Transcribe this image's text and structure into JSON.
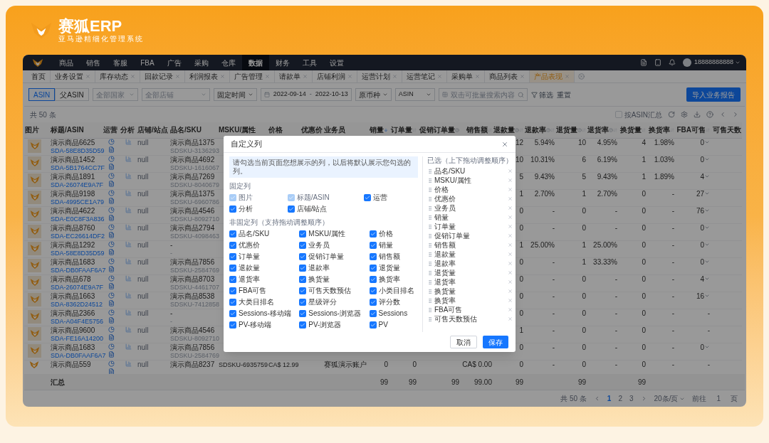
{
  "brand": {
    "name": "赛狐ERP",
    "tagline": "亚马逊精细化管理系统"
  },
  "nav": {
    "items": [
      {
        "label": "商品",
        "selected": false
      },
      {
        "label": "销售",
        "selected": false
      },
      {
        "label": "客服",
        "selected": false
      },
      {
        "label": "FBA",
        "selected": false
      },
      {
        "label": "广告",
        "selected": false
      },
      {
        "label": "采购",
        "selected": false
      },
      {
        "label": "仓库",
        "selected": false
      },
      {
        "label": "数据",
        "selected": true
      },
      {
        "label": "财务",
        "selected": false
      },
      {
        "label": "工具",
        "selected": false
      },
      {
        "label": "设置",
        "selected": false
      }
    ],
    "user": "18888888888"
  },
  "tabs": [
    {
      "label": "首页",
      "selected": false,
      "closable": false
    },
    {
      "label": "业务设置",
      "selected": false,
      "closable": true
    },
    {
      "label": "库存动态",
      "selected": false,
      "closable": true
    },
    {
      "label": "回款记录",
      "selected": false,
      "closable": true
    },
    {
      "label": "利润报表",
      "selected": false,
      "closable": true
    },
    {
      "label": "广告管理",
      "selected": false,
      "closable": true
    },
    {
      "label": "请款单",
      "selected": false,
      "closable": true
    },
    {
      "label": "店铺利润",
      "selected": false,
      "closable": true
    },
    {
      "label": "运营计划",
      "selected": false,
      "closable": true
    },
    {
      "label": "运营笔记",
      "selected": false,
      "closable": true
    },
    {
      "label": "采购单",
      "selected": false,
      "closable": true
    },
    {
      "label": "商品列表",
      "selected": false,
      "closable": true
    },
    {
      "label": "产品表现",
      "selected": true,
      "closable": true
    }
  ],
  "toolbar": {
    "segments": [
      {
        "label": "ASIN",
        "selected": true
      },
      {
        "label": "父ASIN",
        "selected": false
      }
    ],
    "country": "全部国家",
    "shop": "全部店铺",
    "time_mode": "固定时间",
    "date_start": "2022-09-14",
    "date_end": "2022-10-13",
    "date_separator": "-",
    "currency": "原币种",
    "search_type": "ASIN",
    "search_placeholder": "双击可批量搜索内容",
    "filter": "筛选",
    "reset": "重置",
    "import_button": "导入业务报告"
  },
  "table": {
    "total": "共 50 条",
    "group_by_asin": {
      "label": "按ASIN汇总",
      "checked": false
    },
    "columns": [
      {
        "label": "图片",
        "help": false,
        "sortable": false
      },
      {
        "label": "标题/ASIN",
        "help": false,
        "sortable": false
      },
      {
        "label": "运营",
        "help": false,
        "sortable": false
      },
      {
        "label": "分析",
        "help": false,
        "sortable": false
      },
      {
        "label": "店铺/站点",
        "help": false,
        "sortable": false
      },
      {
        "label": "品名/SKU",
        "help": false,
        "sortable": false
      },
      {
        "label": "MSKU/属性",
        "help": false,
        "sortable": false
      },
      {
        "label": "价格",
        "help": false,
        "sortable": false
      },
      {
        "label": "优惠价",
        "help": false,
        "sortable": false
      },
      {
        "label": "业务员",
        "help": false,
        "sortable": false
      },
      {
        "label": "销量",
        "help": false,
        "sortable": true,
        "sorted": true
      },
      {
        "label": "订单量",
        "help": false,
        "sortable": true,
        "sorted": false
      },
      {
        "label": "促销订单量",
        "help": true,
        "sortable": false
      },
      {
        "label": "销售额",
        "help": false,
        "sortable": true,
        "sorted": false
      },
      {
        "label": "退款量",
        "help": true,
        "sortable": true,
        "sorted": false
      },
      {
        "label": "退款率",
        "help": true,
        "sortable": true,
        "sorted": false
      },
      {
        "label": "退货量",
        "help": true,
        "sortable": true,
        "sorted": false
      },
      {
        "label": "退货率",
        "help": true,
        "sortable": true,
        "sorted": false
      },
      {
        "label": "换货量",
        "help": false,
        "sortable": true,
        "sorted": false
      },
      {
        "label": "换货率",
        "help": false,
        "sortable": true,
        "sorted": false
      },
      {
        "label": "FBA可售",
        "help": false,
        "sortable": true,
        "sorted": false
      },
      {
        "label": "可售天数",
        "help": false,
        "sortable": false
      }
    ],
    "rows": [
      {
        "title": "演示商品6625",
        "asin": "SDA-58E8D35D59",
        "shop": "null",
        "pname": "演示商品1375",
        "sku": "SDSKU-3136293",
        "refund_qty": "12",
        "refund_rate": "5.94%",
        "return_qty": "10",
        "return_rate": "4.95%",
        "exchange_qty": "4",
        "exchange_rate": "1.98%",
        "fba": "0",
        "fba_expandable": true
      },
      {
        "title": "演示商品1452",
        "asin": "SDA-5B1764CC7F",
        "shop": "null",
        "pname": "演示商品4692",
        "sku": "SDSKU-1616067",
        "refund_qty": "10",
        "refund_rate": "10.31%",
        "return_qty": "6",
        "return_rate": "6.19%",
        "exchange_qty": "1",
        "exchange_rate": "1.03%",
        "fba": "0",
        "fba_expandable": true
      },
      {
        "title": "演示商品1891",
        "asin": "SDA-26074E9A7F",
        "shop": "null",
        "pname": "演示商品7269",
        "sku": "SDSKU-8040679",
        "refund_qty": "5",
        "refund_rate": "9.43%",
        "return_qty": "5",
        "return_rate": "9.43%",
        "exchange_qty": "1",
        "exchange_rate": "1.89%",
        "fba": "4",
        "fba_expandable": true
      },
      {
        "title": "演示商品9198",
        "asin": "SDA-4995CE1A79",
        "shop": "null",
        "pname": "演示商品1375",
        "sku": "SDSKU-6960786",
        "refund_qty": "1",
        "refund_rate": "2.70%",
        "return_qty": "1",
        "return_rate": "2.70%",
        "exchange_qty": "0",
        "exchange_rate": "-",
        "fba": "27",
        "fba_expandable": true
      },
      {
        "title": "演示商品4622",
        "asin": "SDA-E0C8F3A836",
        "shop": "null",
        "pname": "演示商品4546",
        "sku": "SDSKU-8092710",
        "refund_qty": "0",
        "refund_rate": "-",
        "return_qty": "0",
        "return_rate": "-",
        "exchange_qty": "0",
        "exchange_rate": "-",
        "fba": "76",
        "fba_expandable": true
      },
      {
        "title": "演示商品8760",
        "asin": "SDA-EC26614DF2",
        "shop": "null",
        "pname": "演示商品2794",
        "sku": "SDSKU-4098463",
        "refund_qty": "0",
        "refund_rate": "-",
        "return_qty": "0",
        "return_rate": "-",
        "exchange_qty": "0",
        "exchange_rate": "-",
        "fba": "0",
        "fba_expandable": true
      },
      {
        "title": "演示商品1292",
        "asin": "SDA-58E8D35D59",
        "shop": "null",
        "pname": "-",
        "sku": "-",
        "refund_qty": "1",
        "refund_rate": "25.00%",
        "return_qty": "1",
        "return_rate": "25.00%",
        "exchange_qty": "0",
        "exchange_rate": "-",
        "fba": "0",
        "fba_expandable": true
      },
      {
        "title": "演示商品1683",
        "asin": "SDA-DB0FAAF6A7",
        "shop": "null",
        "pname": "演示商品7856",
        "sku": "SDSKU-2584769",
        "refund_qty": "0",
        "refund_rate": "-",
        "return_qty": "1",
        "return_rate": "33.33%",
        "exchange_qty": "0",
        "exchange_rate": "-",
        "fba": "0",
        "fba_expandable": true
      },
      {
        "title": "演示商品678",
        "asin": "SDA-26074E9A7F",
        "shop": "null",
        "pname": "演示商品8703",
        "sku": "SDSKU-4461707",
        "refund_qty": "0",
        "refund_rate": "-",
        "return_qty": "0",
        "return_rate": "-",
        "exchange_qty": "0",
        "exchange_rate": "-",
        "fba": "4",
        "fba_expandable": true
      },
      {
        "title": "演示商品1663",
        "asin": "SDA-8362D24512",
        "shop": "null",
        "pname": "演示商品8538",
        "sku": "SDSKU-7412858",
        "refund_qty": "0",
        "refund_rate": "-",
        "return_qty": "0",
        "return_rate": "-",
        "exchange_qty": "0",
        "exchange_rate": "-",
        "fba": "16",
        "fba_expandable": true
      },
      {
        "title": "演示商品2366",
        "asin": "SDA-A04F4E5756",
        "shop": "null",
        "pname": "-",
        "sku": "-",
        "refund_qty": "0",
        "refund_rate": "-",
        "return_qty": "0",
        "return_rate": "-",
        "exchange_qty": "0",
        "exchange_rate": "-",
        "fba": "-",
        "fba_expandable": false
      },
      {
        "title": "演示商品9600",
        "asin": "SDA-FE16A14200",
        "shop": "null",
        "pname": "演示商品4546",
        "sku": "SDSKU-8092710",
        "refund_qty": "1",
        "refund_rate": "-",
        "return_qty": "0",
        "return_rate": "-",
        "exchange_qty": "0",
        "exchange_rate": "-",
        "fba": "-",
        "fba_expandable": false
      },
      {
        "title": "演示商品1683",
        "asin": "SDA-DB0FAAF6A7",
        "shop": "null",
        "pname": "演示商品7856",
        "sku": "SDSKU-2584769",
        "refund_qty": "0",
        "refund_rate": "-",
        "return_qty": "0",
        "return_rate": "-",
        "exchange_qty": "0",
        "exchange_rate": "-",
        "fba": "0",
        "fba_expandable": true
      },
      {
        "title": "演示商品559",
        "shop": "null",
        "pname": "演示商品8237",
        "msku": "SDSKU-6935759",
        "price": "CA$ 12.99",
        "salesperson": "赛狐演示账户",
        "sales": "0",
        "orders": "0",
        "amount": "CA$ 0.00",
        "refund_qty": "0",
        "refund_rate": "-",
        "return_qty": "0",
        "return_rate": "-",
        "exchange_qty": "0",
        "exchange_rate": "-",
        "fba": "-",
        "fba_expandable": false
      }
    ],
    "summary": {
      "label": "汇总",
      "sales": "99",
      "orders": "99",
      "promo_orders": "99",
      "amount": "99.00",
      "refund_qty": "99",
      "return_qty": "99",
      "exchange_qty": "99"
    }
  },
  "pagination": {
    "total": "共 50 条",
    "pages": [
      {
        "label": "1",
        "selected": true
      },
      {
        "label": "2",
        "selected": false
      },
      {
        "label": "3",
        "selected": false
      }
    ],
    "page_size": "20条/页",
    "goto_label": "前往",
    "goto_value": "1",
    "page_unit": "页"
  },
  "dialog": {
    "title": "自定义列",
    "notice": "请勾选当前页面您想展示的列，以后将默认展示您勾选的列。",
    "fixed_label": "固定列",
    "fixed": [
      {
        "label": "图片",
        "checked": true,
        "disabled": true
      },
      {
        "label": "标题/ASIN",
        "checked": true,
        "disabled": true
      },
      {
        "label": "运营",
        "checked": true,
        "disabled": false
      },
      {
        "label": "分析",
        "checked": true,
        "disabled": false
      },
      {
        "label": "店铺/站点",
        "checked": true,
        "disabled": false
      }
    ],
    "optional_label": "非固定列（支持拖动调整顺序）",
    "optional": [
      {
        "label": "品名/SKU",
        "checked": true
      },
      {
        "label": "MSKU/属性",
        "checked": true
      },
      {
        "label": "价格",
        "checked": true
      },
      {
        "label": "优惠价",
        "checked": true
      },
      {
        "label": "业务员",
        "checked": true
      },
      {
        "label": "销量",
        "checked": true
      },
      {
        "label": "订单量",
        "checked": true
      },
      {
        "label": "促销订单量",
        "checked": true
      },
      {
        "label": "销售额",
        "checked": true
      },
      {
        "label": "退款量",
        "checked": true
      },
      {
        "label": "退款率",
        "checked": true
      },
      {
        "label": "退货量",
        "checked": true
      },
      {
        "label": "退货率",
        "checked": true
      },
      {
        "label": "换货量",
        "checked": true
      },
      {
        "label": "换货率",
        "checked": true
      },
      {
        "label": "FBA可售",
        "checked": true
      },
      {
        "label": "可售天数预估",
        "checked": true
      },
      {
        "label": "小类目排名",
        "checked": true
      },
      {
        "label": "大类目排名",
        "checked": true
      },
      {
        "label": "星级评分",
        "checked": true
      },
      {
        "label": "评分数",
        "checked": true
      },
      {
        "label": "Sessions-移动端",
        "checked": true
      },
      {
        "label": "Sessions-浏览器",
        "checked": true
      },
      {
        "label": "Sessions",
        "checked": true
      },
      {
        "label": "PV-移动端",
        "checked": true
      },
      {
        "label": "PV-浏览器",
        "checked": true
      },
      {
        "label": "PV",
        "checked": true
      }
    ],
    "selected_label": "已选（上下拖动调整顺序）",
    "selected_items": [
      "品名/SKU",
      "MSKU/属性",
      "价格",
      "优惠价",
      "业务员",
      "销量",
      "订单量",
      "促销订单量",
      "销售额",
      "退款量",
      "退款率",
      "退货量",
      "退货率",
      "换货量",
      "换货率",
      "FBA可售",
      "可售天数预估"
    ],
    "cancel": "取消",
    "save": "保存"
  }
}
